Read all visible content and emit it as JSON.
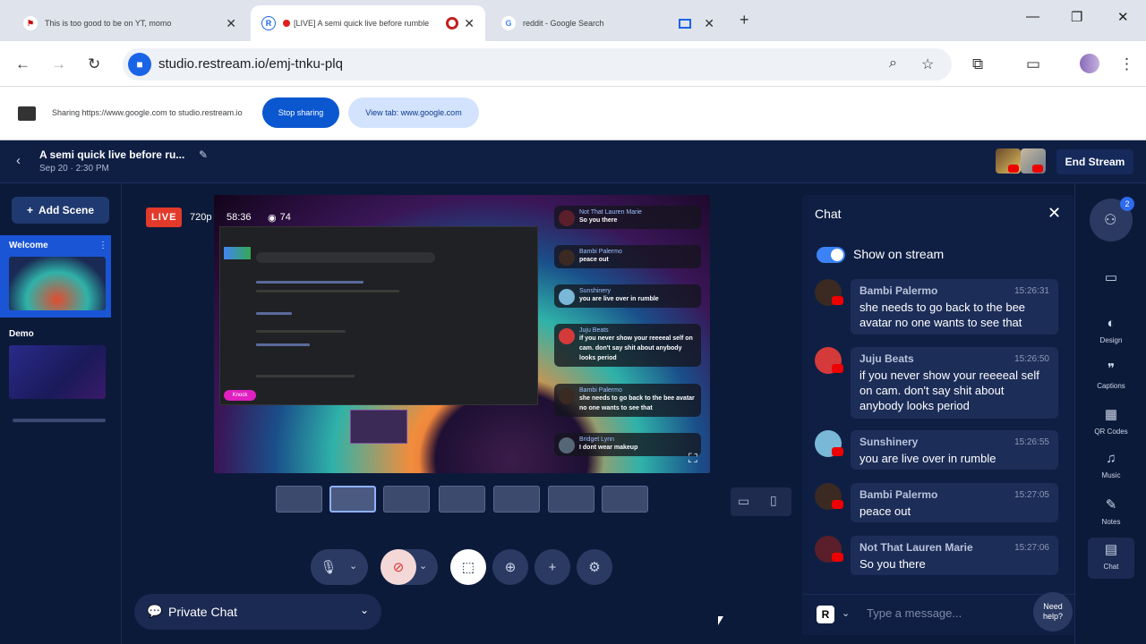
{
  "browser": {
    "tabs": [
      {
        "title": "This is too good to be on YT, momo",
        "active": false
      },
      {
        "title": "[LIVE] A semi quick live before rumble",
        "active": true
      },
      {
        "title": "reddit - Google Search",
        "active": false
      }
    ],
    "url": "studio.restream.io/emj-tnku-plq",
    "new_tab": "+",
    "close": "✕"
  },
  "share_bar": {
    "message": "Sharing https://www.google.com to studio.restream.io",
    "stop_label": "Stop sharing",
    "view_label": "View tab: www.google.com"
  },
  "header": {
    "title": "A semi quick live before ru...",
    "date": "Sep 20 · 2:30 PM",
    "end_stream": "End Stream"
  },
  "scenes": {
    "add_label": "Add Scene",
    "items": [
      {
        "name": "Welcome",
        "active": true
      },
      {
        "name": "Demo",
        "active": false
      }
    ]
  },
  "preview": {
    "live": "LIVE",
    "quality": "720p",
    "elapsed": "58:36",
    "viewers": "74",
    "knock": "Knock",
    "overlay_chat": [
      {
        "name": "Not That Lauren Marie",
        "text": "So you there"
      },
      {
        "name": "Bambi Palermo",
        "text": "peace out"
      },
      {
        "name": "Sunshinery",
        "text": "you are live over in rumble"
      },
      {
        "name": "Juju Beats",
        "text": "if you never show your reeeeal self on cam. don't say shit about anybody looks period"
      },
      {
        "name": "Bambi Palermo",
        "text": "she needs to go back to the bee avatar no one wants to see that"
      },
      {
        "name": "Bridget Lynn",
        "text": "I dont wear makeup"
      }
    ]
  },
  "private_chat": "Private Chat",
  "chat": {
    "title": "Chat",
    "show_on_stream": "Show on stream",
    "messages": [
      {
        "name": "Bambi Palermo",
        "time": "15:26:31",
        "text": "she needs to go back to the bee avatar no one wants to see that",
        "color": "#3a2a22"
      },
      {
        "name": "Juju Beats",
        "time": "15:26:50",
        "text": "if you never show your reeeeal self on cam. don't say shit about anybody looks period",
        "color": "#d43a3a"
      },
      {
        "name": "Sunshinery",
        "time": "15:26:55",
        "text": "you are live over in rumble",
        "color": "#7ab8d8"
      },
      {
        "name": "Bambi Palermo",
        "time": "15:27:05",
        "text": "peace out",
        "color": "#3a2a22"
      },
      {
        "name": "Not That Lauren Marie",
        "time": "15:27:06",
        "text": "So you there",
        "color": "#5a1f2a"
      }
    ],
    "placeholder": "Type a message...",
    "need_help": "Need help?"
  },
  "right_sidebar": {
    "badge": "2",
    "items": [
      {
        "label": "",
        "icon": "folder-icon"
      },
      {
        "label": "Design",
        "icon": "palette-icon"
      },
      {
        "label": "Captions",
        "icon": "captions-icon"
      },
      {
        "label": "QR Codes",
        "icon": "qr-icon"
      },
      {
        "label": "Music",
        "icon": "music-icon"
      },
      {
        "label": "Notes",
        "icon": "notes-icon"
      },
      {
        "label": "Chat",
        "icon": "chat-icon"
      }
    ]
  },
  "colors": {
    "accent": "#1a64e8",
    "live": "#e23a2a",
    "panel": "#0f1f44"
  }
}
